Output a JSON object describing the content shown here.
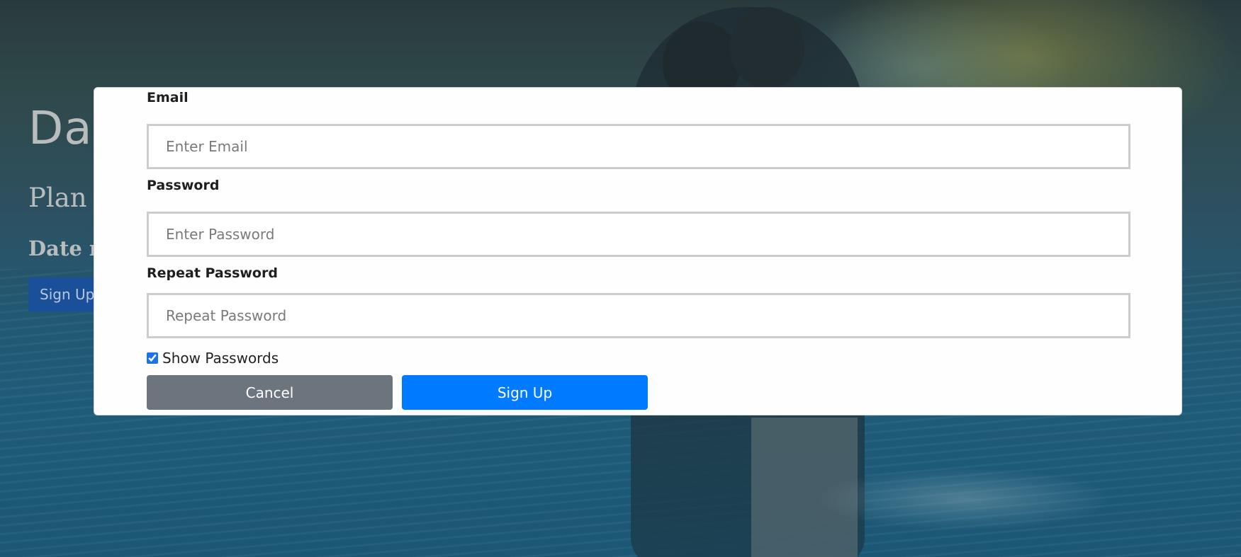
{
  "hero": {
    "title": "Dat",
    "subtitle": "Plan t",
    "tagline": "Date ni",
    "button_label": "Sign Up"
  },
  "modal": {
    "email": {
      "label": "Email",
      "placeholder": "Enter Email",
      "value": ""
    },
    "password": {
      "label": "Password",
      "placeholder": "Enter Password",
      "value": ""
    },
    "repeat_password": {
      "label": "Repeat Password",
      "placeholder": "Repeat Password",
      "value": ""
    },
    "show_passwords": {
      "label": "Show Passwords",
      "checked": true
    },
    "cancel_label": "Cancel",
    "signup_label": "Sign Up"
  },
  "colors": {
    "cancel_button": "#6c757d",
    "signup_button": "#007bff",
    "hero_button": "#1a4f9a"
  }
}
